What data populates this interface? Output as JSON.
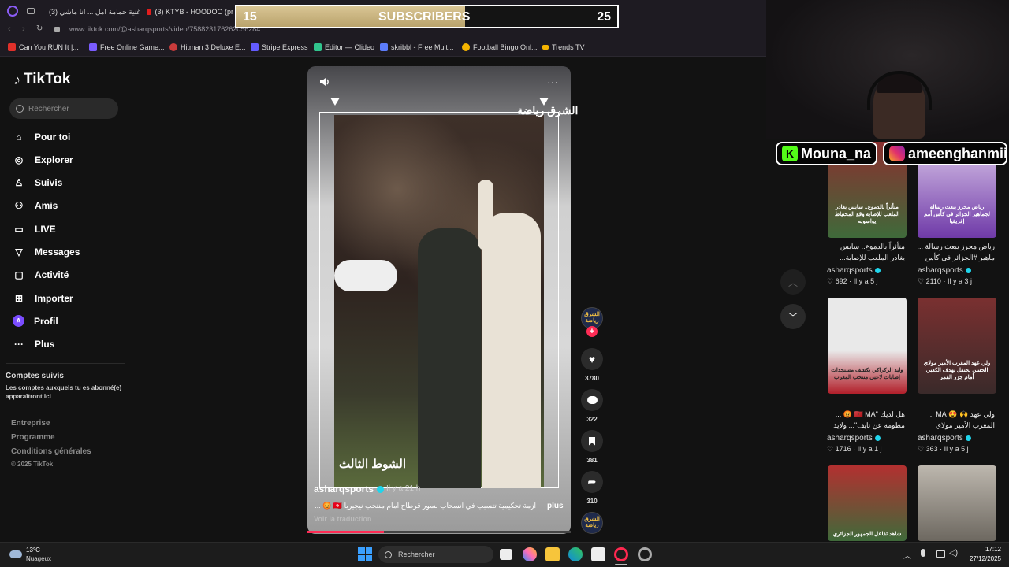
{
  "browser": {
    "tabs": [
      {
        "label": "(3) اغنية حمامة امل ... انا ماشي"
      },
      {
        "label": "(3) KTYB - HOODOO (pr"
      }
    ],
    "url": "www.tiktok.com/@asharqsports/video/758823176262056284",
    "bookmarks": [
      {
        "label": "Can You RUN It |...",
        "color": "#e0302a"
      },
      {
        "label": "Free Online Game...",
        "color": "#7a5cff"
      },
      {
        "label": "Hitman 3 Deluxe E...",
        "color": "#c93b3b"
      },
      {
        "label": "Stripe Express",
        "color": "#635bff"
      },
      {
        "label": "Editor — Clideo",
        "color": "#31c48d"
      },
      {
        "label": "skribbl - Free Mult...",
        "color": "#5c7cfa"
      },
      {
        "label": "Football Bingo Onl...",
        "color": "#f5b400"
      },
      {
        "label": "Trends TV",
        "color": "#f5b400"
      }
    ]
  },
  "overlay": {
    "sub_current": "15",
    "sub_title": "SUBSCRIBERS",
    "sub_goal": "25",
    "sub_progress": 0.6,
    "tag_kick": "Mouna_na",
    "tag_insta": "ameenghanmii"
  },
  "sidebar": {
    "logo": "TikTok",
    "search_placeholder": "Rechercher",
    "nav": [
      {
        "label": "Pour toi",
        "icon": "home-icon"
      },
      {
        "label": "Explorer",
        "icon": "compass-icon"
      },
      {
        "label": "Suivis",
        "icon": "following-icon"
      },
      {
        "label": "Amis",
        "icon": "friends-icon"
      },
      {
        "label": "LIVE",
        "icon": "live-icon"
      },
      {
        "label": "Messages",
        "icon": "messages-icon"
      },
      {
        "label": "Activité",
        "icon": "activity-icon"
      },
      {
        "label": "Importer",
        "icon": "upload-icon"
      },
      {
        "label": "Profil",
        "icon": "profile-icon"
      },
      {
        "label": "Plus",
        "icon": "more-icon"
      }
    ],
    "following_title": "Comptes suivis",
    "following_desc": "Les comptes auxquels tu es abonné(e) apparaîtront ici",
    "footer": [
      "Entreprise",
      "Programme",
      "Conditions générales",
      "© 2025 TikTok"
    ]
  },
  "video": {
    "logo_text": "الشرق رياضة",
    "stamp_text": "الشوط الثالث",
    "author": "asharqsports",
    "time": "Il y a 21 h",
    "description": "أزمة تحكيمية تتسبب في انسحاب نسور قرطاج أمام منتخب نيجيريا 🇹🇳 😡 ...",
    "more_label": "plus",
    "translate_label": "Voir la traduction",
    "progress": 0.29,
    "likes": "3780",
    "comments": "322",
    "saves": "381",
    "shares": "310",
    "avatar_text": "الشرق رياضة"
  },
  "grid": [
    {
      "title": "متأثراً بالدموع.. سايس يغادر الملعب للإصابة...",
      "thumb_text": "متأثراً بالدموع.. سايس يغادر الملعب للإصابة وقع المحتياط يواسونه",
      "author": "asharqsports",
      "likes": "692",
      "age": "Il y a 5 j",
      "bg1": "#8a2f2f",
      "bg2": "#3f6a3a"
    },
    {
      "title": "رياض محرز يبعث رسالة ... ماهير #الجزائر في كأس",
      "thumb_text": "رياض محرز يبعث رسالة لجماهير الجزائر في كأس أمم إفريقيا",
      "author": "asharqsports",
      "likes": "2110",
      "age": "Il y a 3 j",
      "bg1": "#6f3aa8",
      "bg2": "#d8c3e8"
    },
    {
      "title": "هل لديك \"🇲🇦 MA 😡 ... مطومة عن نايف\"... ولايد",
      "thumb_text": "وليد الركراكي يكشف مستجدات إصابات لاعبي منتخب المغرب",
      "author": "asharqsports",
      "likes": "1716",
      "age": "Il y a 1 j",
      "bg1": "#e9e9e9",
      "bg2": "#b21f2a"
    },
    {
      "title": "ولي عهد 🙌 😍 MA ... المغرب الأمير مولاي",
      "thumb_text": "ولي عهد المغرب الأمير مولاي الحسن يحتفل بهدف الكعبي أمام جزر القمر",
      "author": "asharqsports",
      "likes": "363",
      "age": "Il y a 5 j",
      "bg1": "#7a3030",
      "bg2": "#3a2a2a"
    },
    {
      "title": "",
      "thumb_text": "شاهد تفاعل الجمهور الجزائري",
      "author": "",
      "likes": "",
      "age": "",
      "bg1": "#3f6a3a",
      "bg2": "#b33030"
    },
    {
      "title": "",
      "thumb_text": "",
      "author": "",
      "likes": "",
      "age": "",
      "bg1": "#bdb7ae",
      "bg2": "#6d6860"
    }
  ],
  "taskbar": {
    "temp": "13°C",
    "weather": "Nuageux",
    "search_placeholder": "Rechercher",
    "time": "17:12",
    "date": "27/12/2025"
  },
  "colors": {
    "accent": "#fe2c55",
    "verified": "#20d5ec",
    "bg": "#121212"
  }
}
